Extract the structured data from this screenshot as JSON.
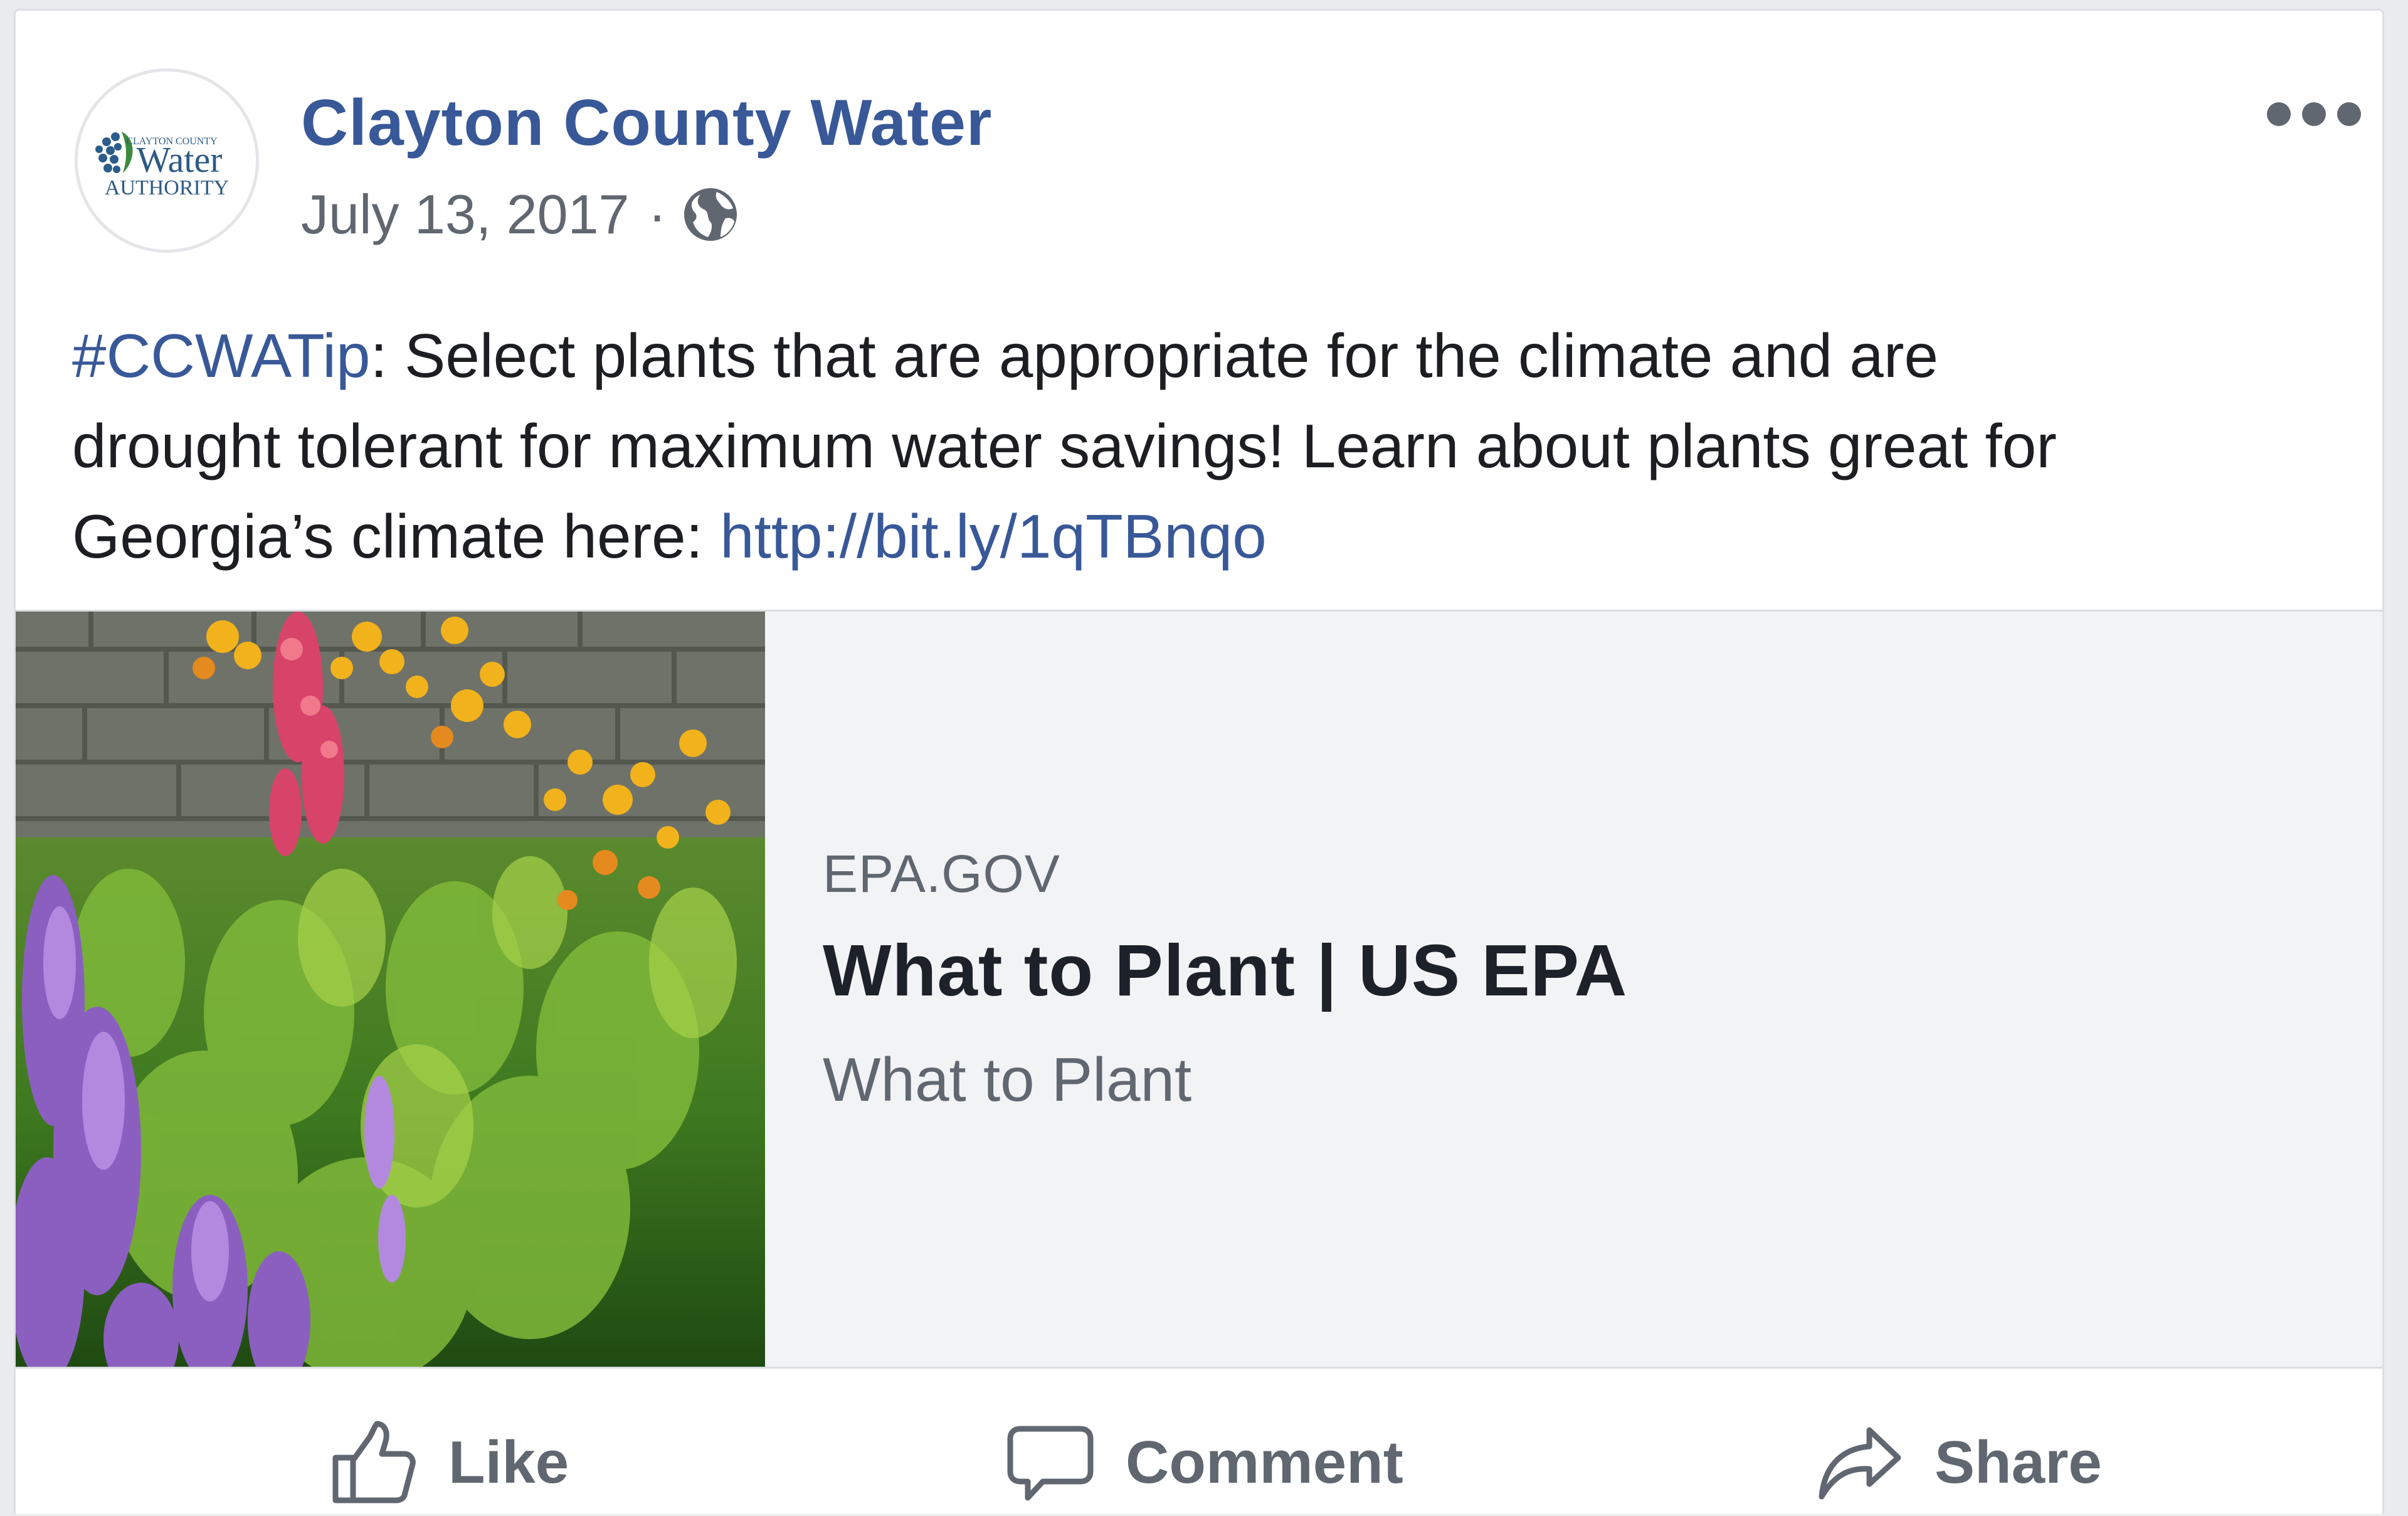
{
  "post": {
    "page_name": "Clayton County Water",
    "date": "July 13, 2017",
    "separator": "·",
    "audience_icon": "globe-icon",
    "more_icon": "more-options-icon",
    "avatar": {
      "logo_top": "CLAYTON COUNTY",
      "logo_main": "Water",
      "logo_bottom": "AUTHORITY"
    },
    "message": {
      "hashtag": "#CCWATip",
      "line1_rest": ": Select plants that are appropriate for the climate and are",
      "line2": "drought tolerant for maximum water savings! Learn about plants great for",
      "line3_text": "Georgia’s climate here: ",
      "link": "http://bit.ly/1qTBnqo"
    },
    "link_preview": {
      "domain": "EPA.GOV",
      "title": "What to Plant | US EPA",
      "description": "What to Plant"
    },
    "actions": {
      "like": "Like",
      "comment": "Comment",
      "share": "Share"
    }
  }
}
